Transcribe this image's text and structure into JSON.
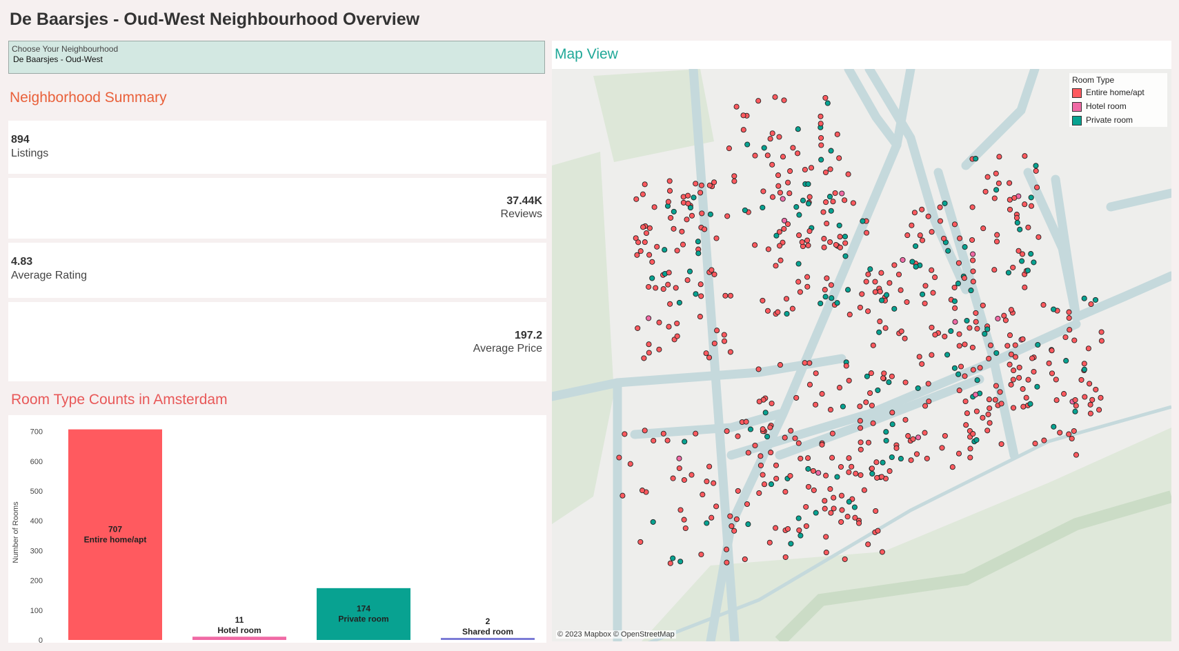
{
  "header": {
    "title": "De Baarsjes - Oud-West Neighbourhood Overview"
  },
  "filter": {
    "label": "Choose Your Neighbourhood",
    "value": "De Baarsjes - Oud-West"
  },
  "summary": {
    "title": "Neighborhood Summary",
    "listings": {
      "value": "894",
      "label": "Listings"
    },
    "reviews": {
      "value": "37.44K",
      "label": "Reviews"
    },
    "rating": {
      "value": "4.83",
      "label": "Average Rating"
    },
    "price": {
      "value": "197.2",
      "label": "Average Price"
    }
  },
  "room_chart": {
    "title": "Room Type Counts in Amsterdam"
  },
  "chart_data": {
    "type": "bar",
    "title": "Room Type Counts in Amsterdam",
    "categories": [
      "Entire home/apt",
      "Hotel room",
      "Private room",
      "Shared room"
    ],
    "values": [
      707,
      11,
      174,
      2
    ],
    "colors": [
      "#ff5a5f",
      "#f06aa5",
      "#08a291",
      "#7b7bd6"
    ],
    "ylabel": "Number of Rooms",
    "xlabel": "",
    "ylim": [
      0,
      720
    ],
    "yticks": [
      0,
      100,
      200,
      300,
      400,
      500,
      600,
      700
    ],
    "grid": false
  },
  "map": {
    "title": "Map View",
    "legend_title": "Room Type",
    "legend": [
      {
        "label": "Entire home/apt",
        "color": "#ff5a5f"
      },
      {
        "label": "Hotel room",
        "color": "#f06aa5"
      },
      {
        "label": "Private room",
        "color": "#08a291"
      }
    ],
    "attribution": "© 2023 Mapbox © OpenStreetMap"
  }
}
